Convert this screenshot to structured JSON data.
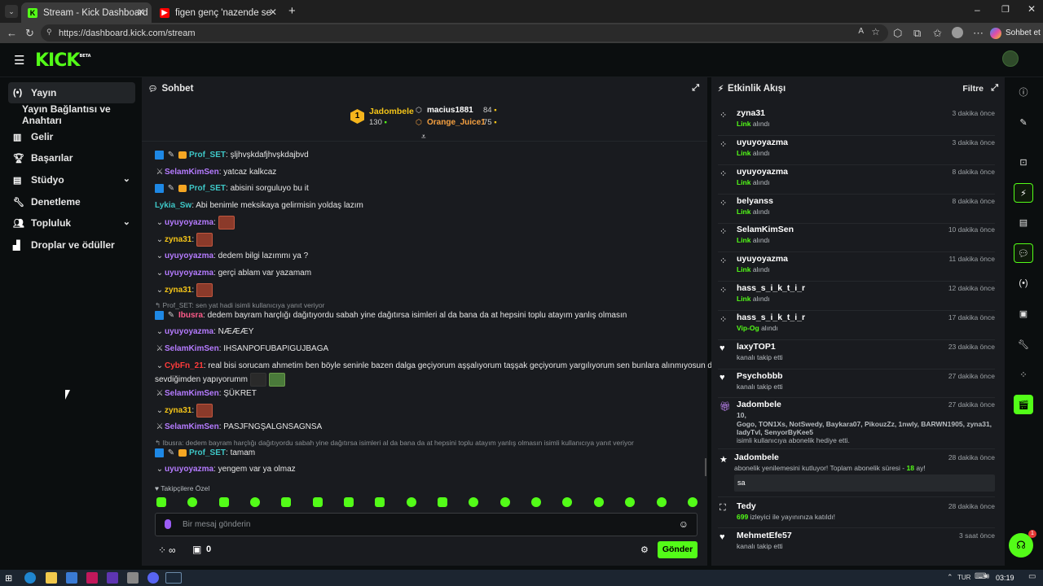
{
  "browser": {
    "tabs": [
      {
        "title": "Stream - Kick Dashboard",
        "active": true
      },
      {
        "title": "figen genç 'nazende sevgilim' (Offi",
        "active": false
      }
    ],
    "url": "https://dashboard.kick.com/stream",
    "copilot_label": "Sohbet et"
  },
  "app": {
    "logo": "KICK",
    "logo_tag": "BETA"
  },
  "nav": {
    "items": [
      {
        "label": "Yayın",
        "icon": "broadcast-icon",
        "active": true
      },
      {
        "label": "Yayın Bağlantısı ve Anahtarı",
        "icon": "",
        "sub": true
      },
      {
        "label": "Gelir",
        "icon": "chart-icon"
      },
      {
        "label": "Başarılar",
        "icon": "trophy-icon"
      },
      {
        "label": "Stüdyo",
        "icon": "studio-icon",
        "expandable": true
      },
      {
        "label": "Denetleme",
        "icon": "wrench-icon"
      },
      {
        "label": "Topluluk",
        "icon": "community-icon",
        "expandable": true
      },
      {
        "label": "Droplar ve ödüller",
        "icon": "drops-icon"
      }
    ]
  },
  "chat": {
    "title": "Sohbet",
    "leaderboard": {
      "first": {
        "rank": "1",
        "name": "Jadombele",
        "count": "130"
      },
      "others": [
        {
          "name": "macius1881",
          "count": "84"
        },
        {
          "name": "Orange_Juice1",
          "count": "75"
        }
      ]
    },
    "messages": [
      {
        "user": "Prof_SET",
        "color": "#3ec7c7",
        "text": ": şljhvşkdafjhvşkdajbvd"
      },
      {
        "user": "SelamKimSen",
        "color": "#b57bff",
        "text": ": yatcaz kalkcaz"
      },
      {
        "user": "Prof_SET",
        "color": "#3ec7c7",
        "text": ": abisini sorguluyo bu it"
      },
      {
        "user": "Lykia_Sw",
        "color": "#3ec7c7",
        "text": ": Abi benimle meksikaya gelirmisin yoldaş lazım"
      },
      {
        "user": "uyuyoyazma",
        "color": "#b57bff",
        "text": ":"
      },
      {
        "user": "zyna31",
        "color": "#f5c518",
        "text": ":"
      },
      {
        "user": "uyuyoyazma",
        "color": "#b57bff",
        "text": ": dedem bilgi lazımmı ya ?"
      },
      {
        "user": "uyuyoyazma",
        "color": "#b57bff",
        "text": ": gerçi ablam var yazamam"
      },
      {
        "user": "zyna31",
        "color": "#f5c518",
        "text": ":"
      },
      {
        "user": "Ibusra",
        "color": "#ff5b8a",
        "text": ": dedem bayram harçlığı dağıtıyordu sabah yine dağıtırsa isimleri al da bana da at hepsini toplu atayım yanlış olmasın"
      },
      {
        "user": "uyuyoyazma",
        "color": "#b57bff",
        "text": ": NÆÆÆY"
      },
      {
        "user": "SelamKimSen",
        "color": "#b57bff",
        "text": ": IHSANPOFUBAPIGUJBAGA"
      },
      {
        "user": "CybFn_21",
        "color": "#ff3b3b",
        "text": ": real bisi sorucam ahmetim ben böyle seninle bazen dalga geçiyorum aşşalıyorum taşşak geçiyorum yargılıyorum sen bunlara alınmıyosun demi"
      },
      {
        "user": "",
        "color": "#e6e6e6",
        "text": "sevdiğimden yapıyorumm"
      },
      {
        "user": "SelamKimSen",
        "color": "#b57bff",
        "text": ": ŞÜKRET"
      },
      {
        "user": "zyna31",
        "color": "#f5c518",
        "text": ":"
      },
      {
        "user": "SelamKimSen",
        "color": "#b57bff",
        "text": ": PASJFNGŞALGNSAGNSA"
      },
      {
        "user": "Prof_SET",
        "color": "#3ec7c7",
        "text": ": tamam"
      },
      {
        "user": "uyuyoyazma",
        "color": "#b57bff",
        "text": ": yengem var ya olmaz"
      }
    ],
    "replies": [
      "Prof_SET: sen yat hadi isimli kullanıcıya yanıt veriyor",
      "Ibusra: dedem bayram harçlığı dağıtıyordu sabah yine dağıtırsa isimleri al da bana da at hepsini toplu atayım yanlış olmasın isimli kullanıcıya yanıt veriyor"
    ],
    "followers_only": "Takipçilere Özel",
    "input_placeholder": "Bir mesaj gönderin",
    "viewer_symbol": "∞",
    "box_count": "0",
    "send_label": "Gönder"
  },
  "feed": {
    "title": "Etkinlik Akışı",
    "filter_label": "Filtre",
    "items": [
      {
        "name": "zyna31",
        "time": "3 dakika önce",
        "hl": "Link",
        "sub": " alındı",
        "icon": "points-icon"
      },
      {
        "name": "uyuyoyazma",
        "time": "3 dakika önce",
        "hl": "Link",
        "sub": " alındı",
        "icon": "points-icon"
      },
      {
        "name": "uyuyoyazma",
        "time": "8 dakika önce",
        "hl": "Link",
        "sub": " alındı",
        "icon": "points-icon"
      },
      {
        "name": "belyanss",
        "time": "8 dakika önce",
        "hl": "Link",
        "sub": " alındı",
        "icon": "points-icon"
      },
      {
        "name": "SelamKimSen",
        "time": "10 dakika önce",
        "hl": "Link",
        "sub": " alındı",
        "icon": "points-icon"
      },
      {
        "name": "uyuyoyazma",
        "time": "11 dakika önce",
        "hl": "Link",
        "sub": " alındı",
        "icon": "points-icon"
      },
      {
        "name": "hass_s_i_k_t_i_r",
        "time": "12 dakika önce",
        "hl": "Link",
        "sub": " alındı",
        "icon": "points-icon"
      },
      {
        "name": "hass_s_i_k_t_i_r",
        "time": "17 dakika önce",
        "hl": "Vip-Og",
        "sub": " alındı",
        "icon": "points-icon"
      },
      {
        "name": "laxyTOP1",
        "time": "23 dakika önce",
        "hl": "",
        "sub": "kanalı takip etti",
        "icon": "heart-icon"
      },
      {
        "name": "Psychobbb",
        "time": "27 dakika önce",
        "hl": "",
        "sub": "kanalı takip etti",
        "icon": "heart-icon"
      }
    ],
    "gift": {
      "name": "Jadombele",
      "time": "27 dakika önce",
      "count": "10,",
      "list": "Gogo, TON1Xs, NotSwedy, Baykara07, PikouzZz, 1nwly, BARWN1905, zyna31,",
      "list2": "ladyTvl, SenyorByKee5",
      "sub": "isimli kullanıcıya abonelik hediye etti."
    },
    "resub": {
      "name": "Jadombele",
      "time": "28 dakika önce",
      "text": "abonelik yenilemesini kutluyor! Toplam abonelik süresi - ",
      "months": "18",
      "unit": " ay!",
      "message": "sa"
    },
    "host": {
      "name": "Tedy",
      "time": "28 dakika önce",
      "count": "699",
      "sub": " izleyici ile yayınınıza katıldı!"
    },
    "follow": {
      "name": "MehmetEfe57",
      "time": "3 saat önce",
      "sub": "kanalı takip etti"
    }
  },
  "taskbar": {
    "lang": "TUR",
    "time": "03:19"
  },
  "colors": {
    "brand": "#53fc18"
  }
}
